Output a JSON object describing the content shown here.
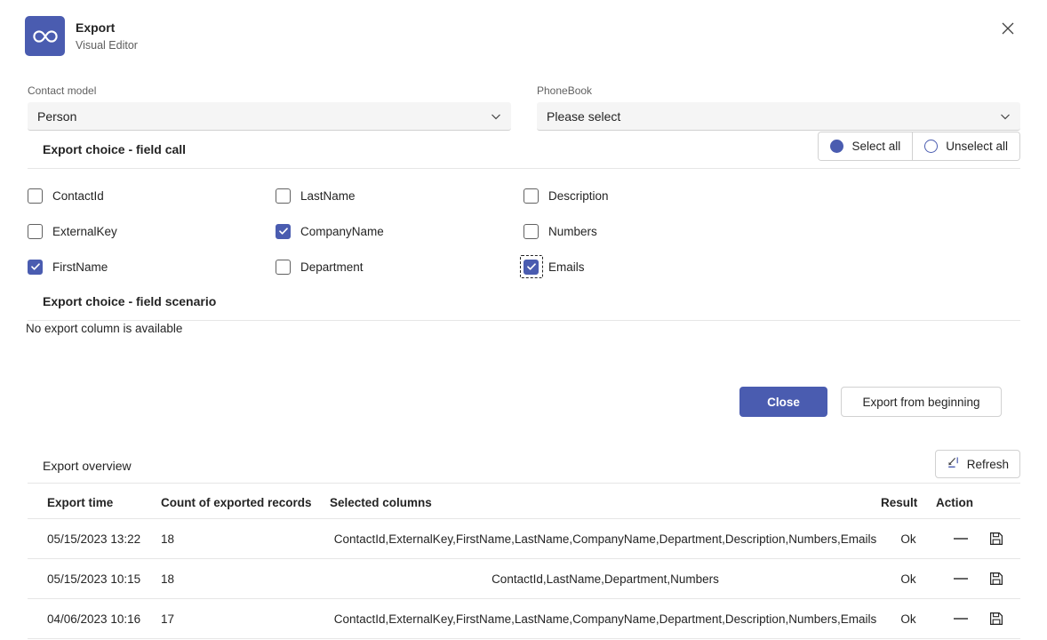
{
  "header": {
    "logo_icon": "infinity-icon",
    "title": "Export",
    "subtitle": "Visual Editor",
    "close_icon": "close-icon",
    "brand_color": "#4a5cb0"
  },
  "form": {
    "contact_model": {
      "label": "Contact model",
      "value": "Person",
      "chevron_icon": "chevron-down-icon"
    },
    "phonebook": {
      "label": "PhoneBook",
      "value": "Please select",
      "chevron_icon": "chevron-down-icon"
    }
  },
  "field_call_section": {
    "title": "Export choice - field call",
    "select_all_label": "Select all",
    "unselect_all_label": "Unselect all",
    "fields": [
      [
        {
          "label": "ContactId",
          "checked": false
        },
        {
          "label": "LastName",
          "checked": false
        },
        {
          "label": "Description",
          "checked": false
        }
      ],
      [
        {
          "label": "ExternalKey",
          "checked": false
        },
        {
          "label": "CompanyName",
          "checked": true
        },
        {
          "label": "Numbers",
          "checked": false
        }
      ],
      [
        {
          "label": "FirstName",
          "checked": true
        },
        {
          "label": "Department",
          "checked": false
        },
        {
          "label": "Emails",
          "checked": true,
          "focused": true
        }
      ]
    ]
  },
  "field_scenario_section": {
    "title": "Export choice - field scenario",
    "empty_message": "No export column is available"
  },
  "actions": {
    "close_label": "Close",
    "export_label": "Export from beginning"
  },
  "overview": {
    "title": "Export overview",
    "refresh_label": "Refresh",
    "refresh_icon": "refresh-arrow-icon",
    "columns": [
      "Export time",
      "Count of exported records",
      "Selected columns",
      "Result",
      "Action"
    ],
    "rows": [
      {
        "time": "05/15/2023 13:22",
        "count": "18",
        "columns": "ContactId,ExternalKey,FirstName,LastName,CompanyName,Department,Description,Numbers,Emails",
        "result": "Ok",
        "action_icons": [
          "minus-icon",
          "save-icon"
        ]
      },
      {
        "time": "05/15/2023 10:15",
        "count": "18",
        "columns": "ContactId,LastName,Department,Numbers",
        "result": "Ok",
        "action_icons": [
          "minus-icon",
          "save-icon"
        ]
      },
      {
        "time": "04/06/2023 10:16",
        "count": "17",
        "columns": "ContactId,ExternalKey,FirstName,LastName,CompanyName,Department,Description,Numbers,Emails",
        "result": "Ok",
        "action_icons": [
          "minus-icon",
          "save-icon"
        ]
      }
    ]
  }
}
